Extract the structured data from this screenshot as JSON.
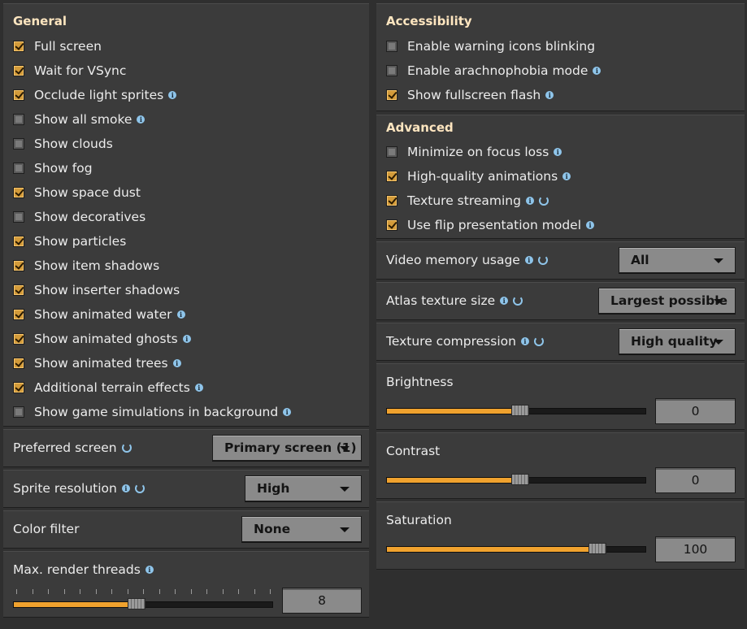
{
  "general": {
    "heading": "General",
    "options": [
      {
        "label": "Full screen",
        "checked": true,
        "info": false
      },
      {
        "label": "Wait for VSync",
        "checked": true,
        "info": false
      },
      {
        "label": "Occlude light sprites",
        "checked": true,
        "info": true
      },
      {
        "label": "Show all smoke",
        "checked": false,
        "info": true
      },
      {
        "label": "Show clouds",
        "checked": false,
        "info": false
      },
      {
        "label": "Show fog",
        "checked": false,
        "info": false
      },
      {
        "label": "Show space dust",
        "checked": true,
        "info": false
      },
      {
        "label": "Show decoratives",
        "checked": false,
        "info": false
      },
      {
        "label": "Show particles",
        "checked": true,
        "info": false
      },
      {
        "label": "Show item shadows",
        "checked": true,
        "info": false
      },
      {
        "label": "Show inserter shadows",
        "checked": true,
        "info": false
      },
      {
        "label": "Show animated water",
        "checked": true,
        "info": true
      },
      {
        "label": "Show animated ghosts",
        "checked": true,
        "info": true
      },
      {
        "label": "Show animated trees",
        "checked": true,
        "info": true
      },
      {
        "label": "Additional terrain effects",
        "checked": true,
        "info": true
      },
      {
        "label": "Show game simulations in background",
        "checked": false,
        "info": true
      }
    ]
  },
  "preferred_screen": {
    "label": "Preferred screen",
    "value": "Primary screen (1)"
  },
  "sprite_resolution": {
    "label": "Sprite resolution",
    "value": "High"
  },
  "color_filter": {
    "label": "Color filter",
    "value": "None"
  },
  "render_threads": {
    "label": "Max. render threads",
    "value": "8",
    "fraction": 0.46
  },
  "accessibility": {
    "heading": "Accessibility",
    "options": [
      {
        "label": "Enable warning icons blinking",
        "checked": false,
        "info": false
      },
      {
        "label": "Enable arachnophobia mode",
        "checked": false,
        "info": true
      },
      {
        "label": "Show fullscreen flash",
        "checked": true,
        "info": true
      }
    ]
  },
  "advanced": {
    "heading": "Advanced",
    "options": [
      {
        "label": "Minimize on focus loss",
        "checked": false,
        "info": true,
        "reset": false
      },
      {
        "label": "High-quality animations",
        "checked": true,
        "info": true,
        "reset": false
      },
      {
        "label": "Texture streaming",
        "checked": true,
        "info": true,
        "reset": true
      },
      {
        "label": "Use flip presentation model",
        "checked": true,
        "info": true,
        "reset": false
      }
    ]
  },
  "video_memory": {
    "label": "Video memory usage",
    "value": "All"
  },
  "atlas_size": {
    "label": "Atlas texture size",
    "value": "Largest possible"
  },
  "texture_compression": {
    "label": "Texture compression",
    "value": "High quality"
  },
  "brightness": {
    "label": "Brightness",
    "value": "0",
    "fraction": 0.5
  },
  "contrast": {
    "label": "Contrast",
    "value": "0",
    "fraction": 0.5
  },
  "saturation": {
    "label": "Saturation",
    "value": "100",
    "fraction": 0.8
  },
  "colors": {
    "accent": "#f0a22e",
    "checkbox_on": "#d39b3a",
    "heading": "#ffe6c0",
    "info": "#8fc5ea"
  }
}
